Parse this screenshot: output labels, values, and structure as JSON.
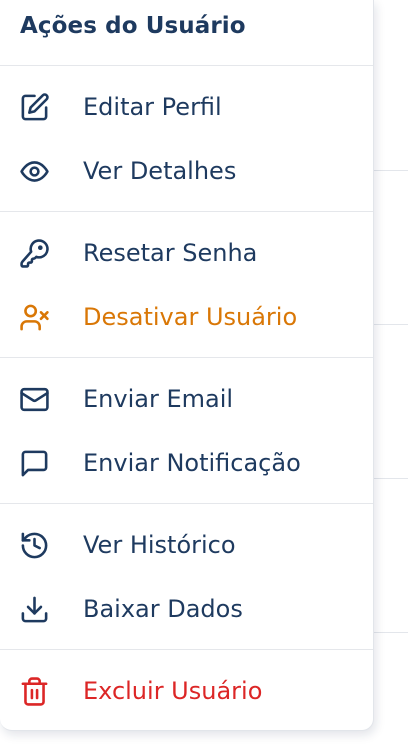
{
  "menu": {
    "title": "Ações do Usuário",
    "groups": [
      {
        "items": [
          {
            "label": "Editar Perfil",
            "icon": "edit-icon"
          },
          {
            "label": "Ver Detalhes",
            "icon": "eye-icon"
          }
        ]
      },
      {
        "items": [
          {
            "label": "Resetar Senha",
            "icon": "key-icon"
          },
          {
            "label": "Desativar Usuário",
            "icon": "user-x-icon",
            "color": "#d97706"
          }
        ]
      },
      {
        "items": [
          {
            "label": "Enviar Email",
            "icon": "mail-icon"
          },
          {
            "label": "Enviar Notificação",
            "icon": "message-square-icon"
          }
        ]
      },
      {
        "items": [
          {
            "label": "Ver Histórico",
            "icon": "history-icon"
          },
          {
            "label": "Baixar Dados",
            "icon": "download-icon"
          }
        ]
      },
      {
        "items": [
          {
            "label": "Excluir Usuário",
            "icon": "trash-icon",
            "color": "#dc2626"
          }
        ]
      }
    ]
  },
  "colors": {
    "text": "#1e3a5f",
    "warning": "#d97706",
    "danger": "#dc2626",
    "divider": "#e5e7eb"
  }
}
